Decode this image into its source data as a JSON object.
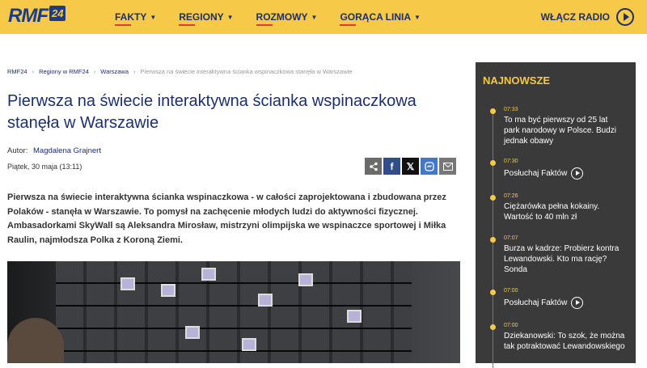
{
  "header": {
    "logo_text": "RMF",
    "logo_number": "24",
    "nav": [
      {
        "label": "FAKTY"
      },
      {
        "label": "REGIONY"
      },
      {
        "label": "ROZMOWY"
      },
      {
        "label": "GORĄCA LINIA"
      }
    ],
    "radio_label": "WŁĄCZ RADIO",
    "brand_color": "#f7c948",
    "accent_color": "#1c2f6e"
  },
  "breadcrumb": [
    "RMF24",
    "Regiony w RMF24",
    "Warszawa",
    "Pierwsza na świecie interaktywna ścianka wspinaczkowa stanęła w Warszawie"
  ],
  "article": {
    "title": "Pierwsza na świecie interaktywna ścianka wspinaczkowa stanęła w Warszawie",
    "author_label": "Autor:",
    "author_name": "Magdalena Grajnert",
    "date": "Piątek, 30 maja (13:11)",
    "lead": "Pierwsza na świecie interaktywna ścianka wspinaczkowa - w całości zaprojektowana i zbudowana przez Polaków - stanęła w Warszawie. To pomysł na zachęcenie młodych ludzi do aktywności fizycznej. Ambasadorkami SkyWall są Aleksandra Mirosław, mistrzyni olimpijska we wspinaczce sportowej i Miłka Raulin, najmłodsza Polka z Koroną Ziemi."
  },
  "share": [
    {
      "icon": "share-icon"
    },
    {
      "icon": "facebook-icon"
    },
    {
      "icon": "x-icon"
    },
    {
      "icon": "messenger-icon"
    },
    {
      "icon": "mail-icon"
    }
  ],
  "sidebar": {
    "heading": "NAJNOWSZE",
    "items": [
      {
        "time": "07:33",
        "text": "To ma być pierwszy od 25 lat park narodowy w Polsce. Budzi jednak obawy",
        "play": false
      },
      {
        "time": "07:30",
        "text": "Posłuchaj Faktów",
        "play": true
      },
      {
        "time": "07:26",
        "text": "Ciężarówka pełna kokainy. Wartość to 40 mln zł",
        "play": false
      },
      {
        "time": "07:07",
        "text": "Burza w kadrze: Probierz kontra Lewandowski. Kto ma rację? Sonda",
        "play": false
      },
      {
        "time": "07:00",
        "text": "Posłuchaj Faktów",
        "play": true
      },
      {
        "time": "07:00",
        "text": "Dziekanowski: To szok, że można tak potraktować Lewandowskiego",
        "play": false
      }
    ]
  }
}
